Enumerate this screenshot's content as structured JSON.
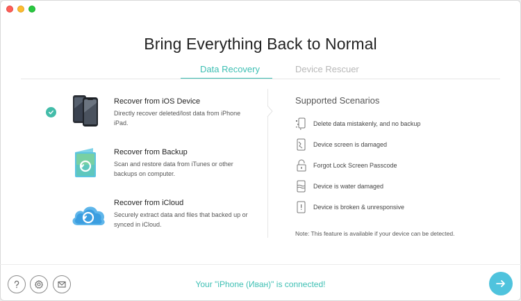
{
  "window": {
    "controls": [
      "close",
      "minimize",
      "zoom"
    ]
  },
  "header": {
    "title": "Bring Everything Back to Normal"
  },
  "tabs": [
    {
      "label": "Data Recovery",
      "active": true
    },
    {
      "label": "Device Rescuer",
      "active": false
    }
  ],
  "options": [
    {
      "title": "Recover from iOS Device",
      "description": "Directly recover deleted/lost data from iPhone iPad.",
      "selected": true,
      "icon": "iphone-device-icon"
    },
    {
      "title": "Recover from Backup",
      "description": "Scan and restore data from iTunes or other backups on computer.",
      "selected": false,
      "icon": "backup-restore-icon"
    },
    {
      "title": "Recover from iCloud",
      "description": "Securely extract data and files that backed up or synced in iCloud.",
      "selected": false,
      "icon": "icloud-icon"
    }
  ],
  "scenarios": {
    "title": "Supported Scenarios",
    "items": [
      {
        "label": "Delete data mistakenly, and no backup",
        "icon": "deleted-data-icon"
      },
      {
        "label": "Device screen is damaged",
        "icon": "broken-screen-icon"
      },
      {
        "label": "Forgot Lock Screen Passcode",
        "icon": "lock-icon"
      },
      {
        "label": "Device is water damaged",
        "icon": "water-damage-icon"
      },
      {
        "label": "Device is broken & unresponsive",
        "icon": "unresponsive-device-icon"
      }
    ],
    "note": "Note: This feature is available if your device can be detected."
  },
  "footer": {
    "status": "Your \"iPhone (Иван)\" is connected!",
    "buttons": [
      "help-icon",
      "settings-icon",
      "mail-icon"
    ],
    "next_icon": "arrow-right-icon"
  },
  "colors": {
    "accent": "#3dbfb3",
    "check": "#43bca9",
    "next_button": "#4fc3dd"
  }
}
